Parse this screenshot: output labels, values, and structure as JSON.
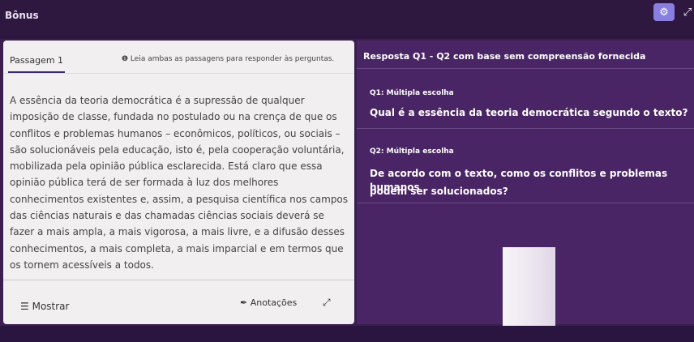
{
  "header": {
    "title": "Bônus"
  },
  "passage_panel": {
    "tab_label": "Passagem 1",
    "hint": "❶ Leia ambas as passagens para responder às perguntas.",
    "lines": [
      "A essência da teoria democrática é a supressão de qualquer",
      "imposição de classe, fundada no postulado ou na crença de que os",
      "conflitos e problemas humanos – econômicos, políticos, ou sociais –",
      "são solucionáveis pela educação, isto é, pela cooperação voluntária,",
      "mobilizada pela opinião pública esclarecida. Está claro que essa",
      "opinião pública terá de ser formada à luz dos melhores",
      "conhecimentos existentes e, assim, a pesquisa científica nos campos",
      "das ciências naturais e das chamadas ciências sociais deverá se",
      "fazer a mais ampla, a mais vigorosa, a mais livre, e a difusão desses",
      "conhecimentos, a mais completa, a mais imparcial e em termos que",
      "os tornem acessíveis a todos."
    ],
    "show_label": "Mostrar",
    "notes_label": "Anotações"
  },
  "question_panel": {
    "header": "Resposta Q1 - Q2 com base sem compreensão fornecida",
    "q1_type": "Q1: Múltipla escolha",
    "q1_text": "Qual é a essência da teoria democrática segundo o texto?",
    "q2_type": "Q2: Múltipla escolha",
    "q2_text_line1": "De acordo com o texto, como os conflitos e problemas humanos",
    "q2_text_line2": "podem ser solucionados?"
  }
}
